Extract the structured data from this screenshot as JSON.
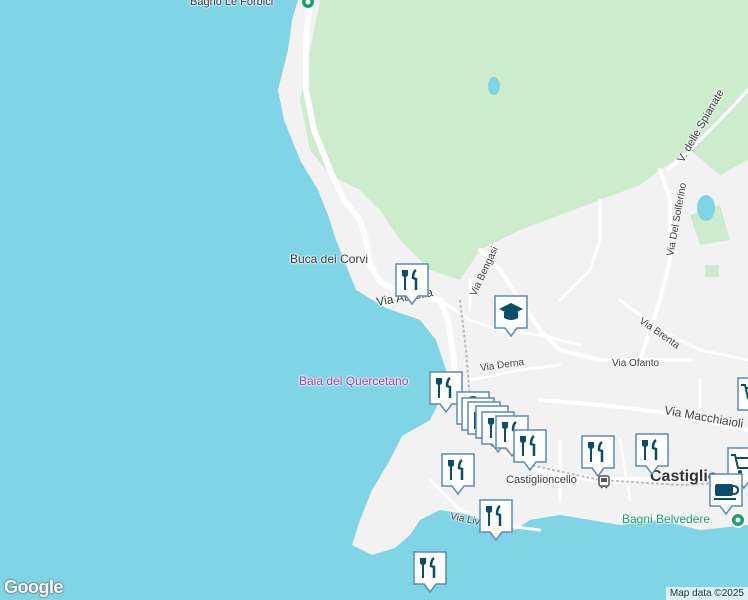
{
  "map": {
    "colors": {
      "water": "#7fd4e6",
      "land": "#f2f2f2",
      "park": "#cdeccd",
      "road": "#ffffff",
      "marker": "#0b4d6b"
    },
    "labels": {
      "bagno_le_forbici": "Bagno Le Forbici",
      "buca_dei_corvi": "Buca dei Corvi",
      "via_aurelia": "Via Aurelia",
      "baia_del_quercetano": "Baia del Quercetano",
      "via_bengasi": "Via Bengasi",
      "via_derna": "Via Derna",
      "via_ofanto": "Via Ofanto",
      "via_brenta": "Via Brenta",
      "via_macchiaioli": "Via Macchiaioli",
      "via_del_solferino": "Via Del Solferino",
      "v_delle_spianate": "V. delle Spianate",
      "castiglioncello_small": "Castiglioncello",
      "castiglio_large": "Castiglio",
      "bagni_belvedere": "Bagni Belvedere",
      "via_liv": "Via Liv"
    },
    "attribution": "Map data ©2025",
    "logo": "Google",
    "icons": [
      "restaurant-icon",
      "school-icon",
      "cafe-icon",
      "shopping-cart-icon",
      "shopping-bag-icon",
      "beach-pin-icon",
      "train-station-icon"
    ]
  }
}
